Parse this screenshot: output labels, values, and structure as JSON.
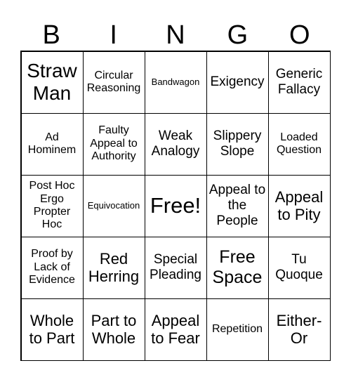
{
  "header": [
    "B",
    "I",
    "N",
    "G",
    "O"
  ],
  "cells": [
    "Straw Man",
    "Circular Reasoning",
    "Bandwagon",
    "Exigency",
    "Generic Fallacy",
    "Ad Hominem",
    "Faulty Appeal to Authority",
    "Weak Analogy",
    "Slippery Slope",
    "Loaded Question",
    "Post Hoc Ergo Propter Hoc",
    "Equivocation",
    "Free!",
    "Appeal to the People",
    "Appeal to Pity",
    "Proof by Lack of Evidence",
    "Red Herring",
    "Special Pleading",
    "Free Space",
    "Tu Quoque",
    "Whole to Part",
    "Part to Whole",
    "Appeal to Fear",
    "Repetition",
    "Either-Or"
  ]
}
